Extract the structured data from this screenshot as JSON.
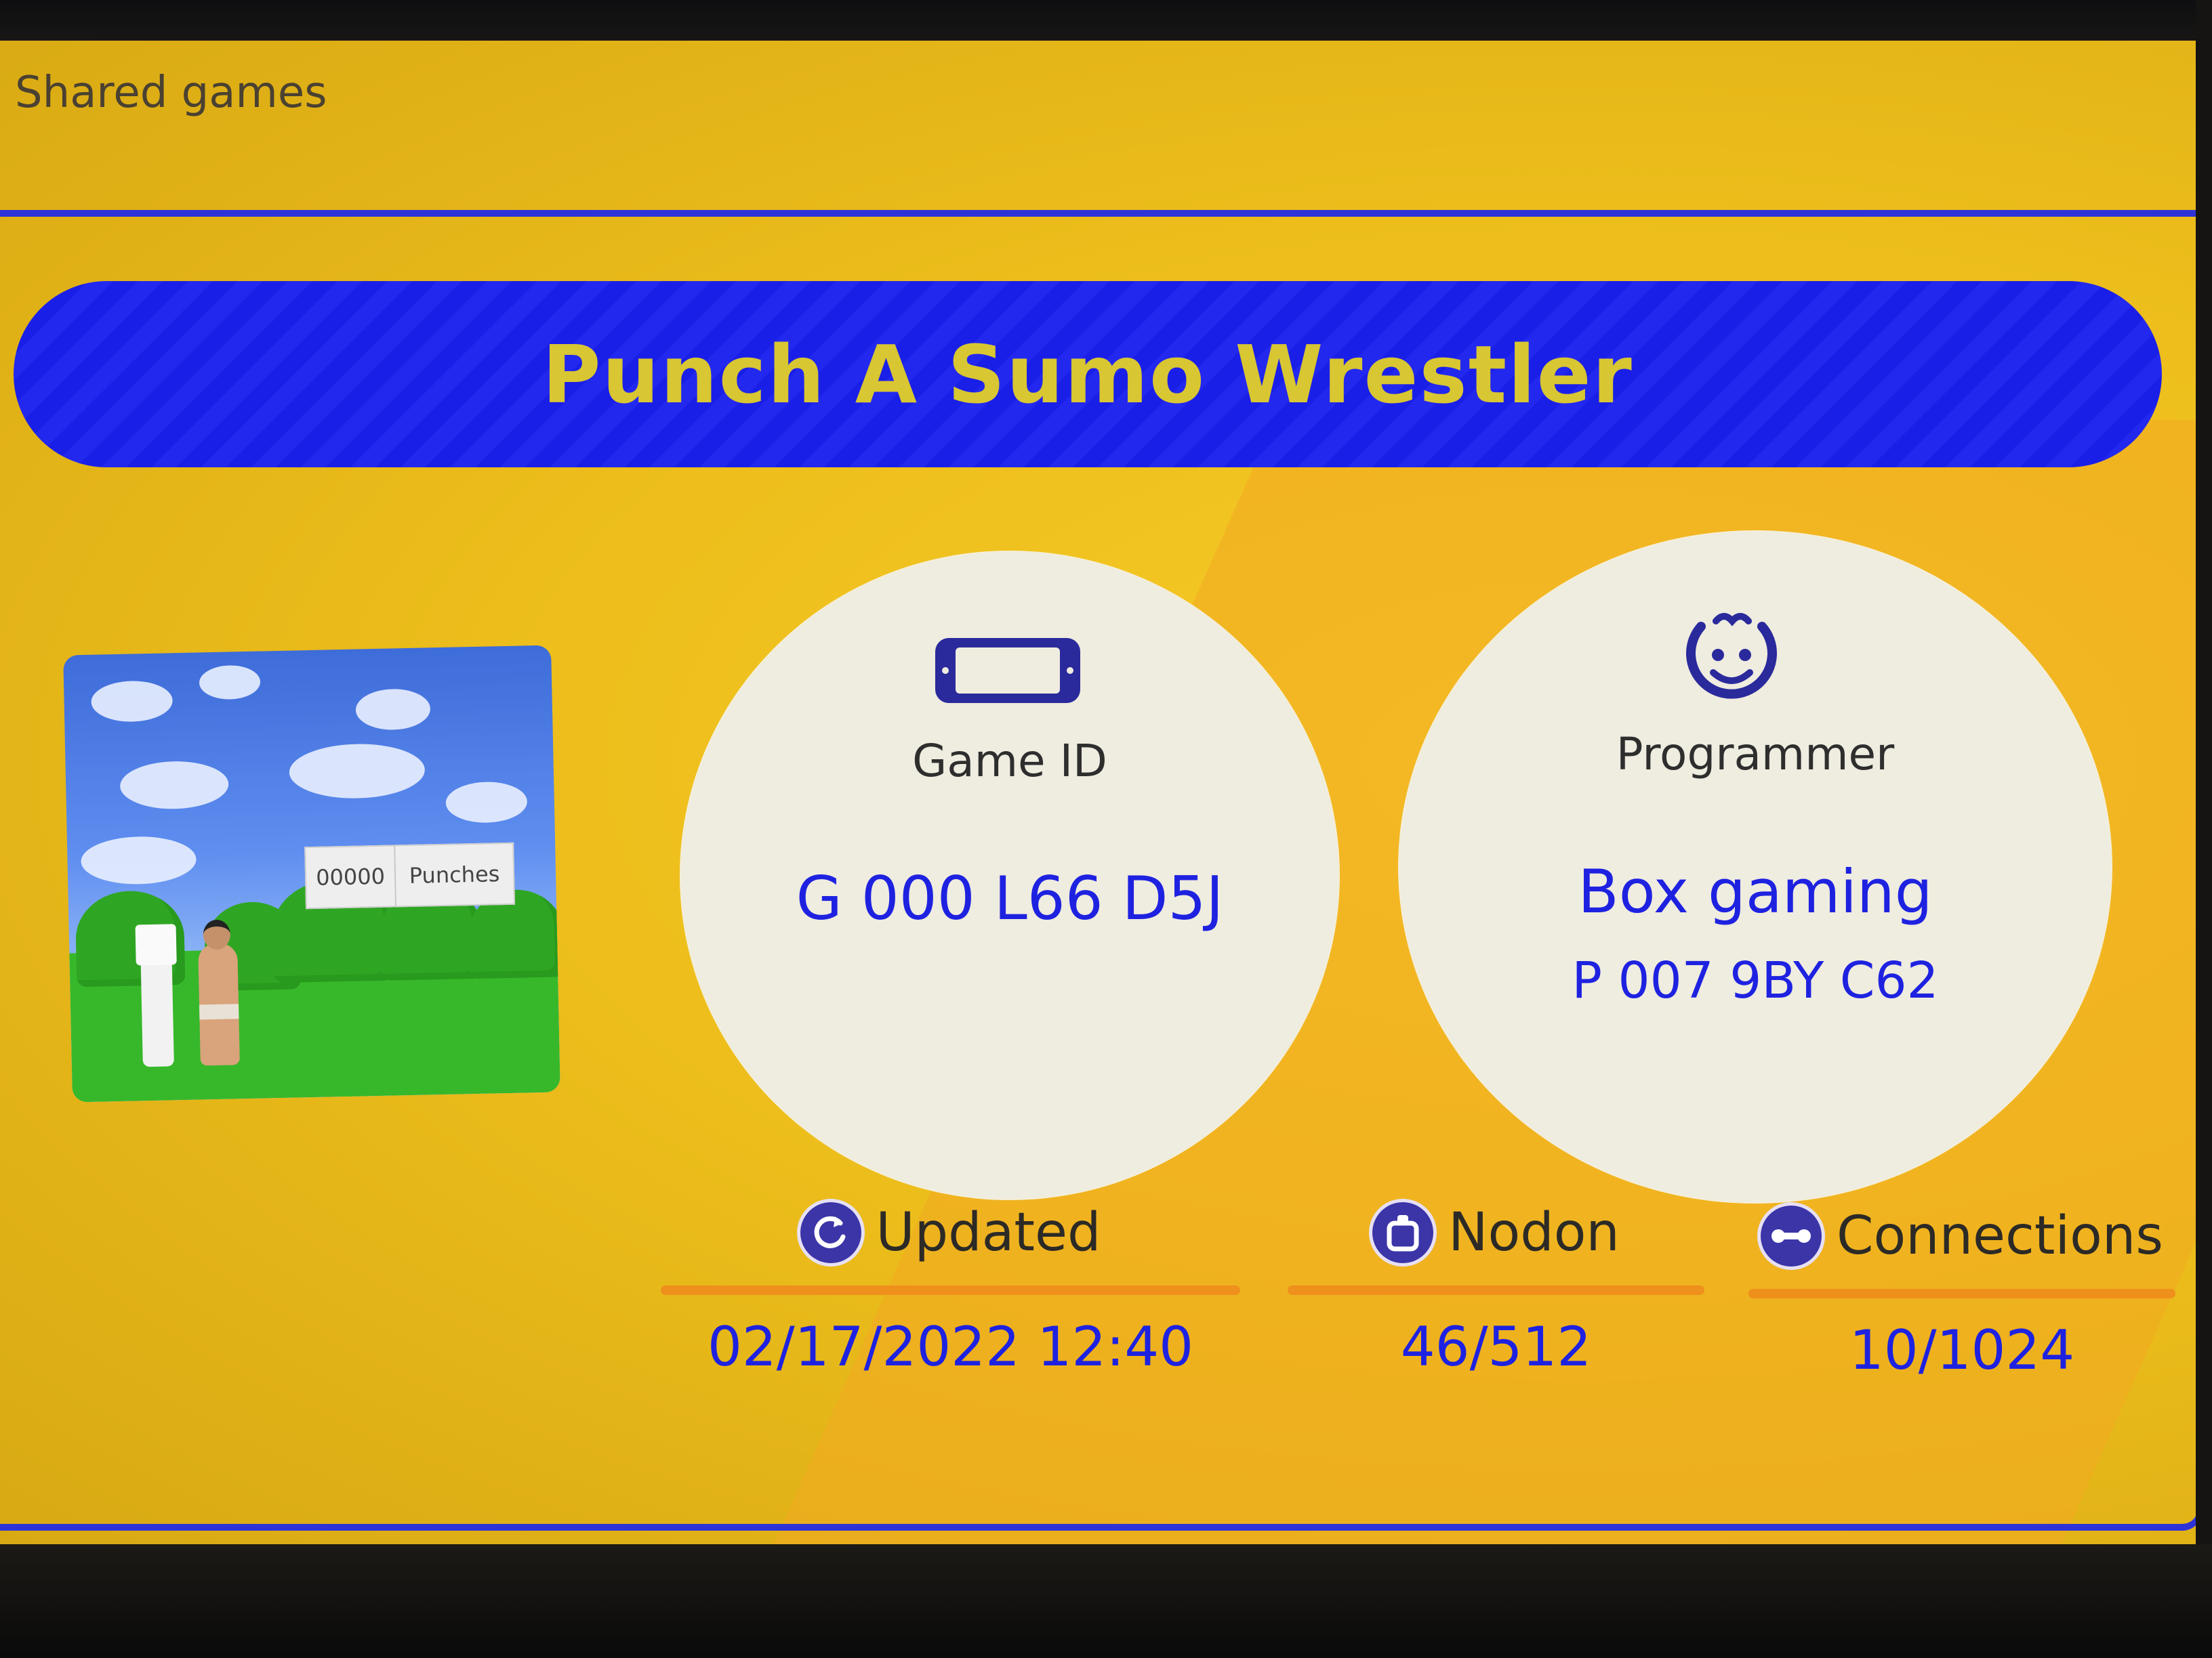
{
  "header": {
    "section_title": "Shared games"
  },
  "game": {
    "title": "Punch A Sumo Wrestler",
    "thumbnail": {
      "score_value": "00000",
      "score_label": "Punches"
    }
  },
  "game_id": {
    "icon": "switch-console-icon",
    "label": "Game ID",
    "value": "G 000 L66 D5J"
  },
  "programmer": {
    "icon": "smiling-face-icon",
    "label": "Programmer",
    "name": "Box gaming",
    "id": "P 007 9BY C62"
  },
  "stats": {
    "updated": {
      "icon": "refresh-icon",
      "label": "Updated",
      "value": "02/17/2022 12:40"
    },
    "nodon": {
      "icon": "nodon-icon",
      "label": "Nodon",
      "value": "46/512"
    },
    "connections": {
      "icon": "connection-icon",
      "label": "Connections",
      "value": "10/1024"
    }
  },
  "colors": {
    "background": "#e9bd1f",
    "accent_blue": "#1e22e0",
    "title_text": "#d8c632",
    "divider_orange": "#ef8f1c",
    "circle_fill": "#efece0"
  }
}
